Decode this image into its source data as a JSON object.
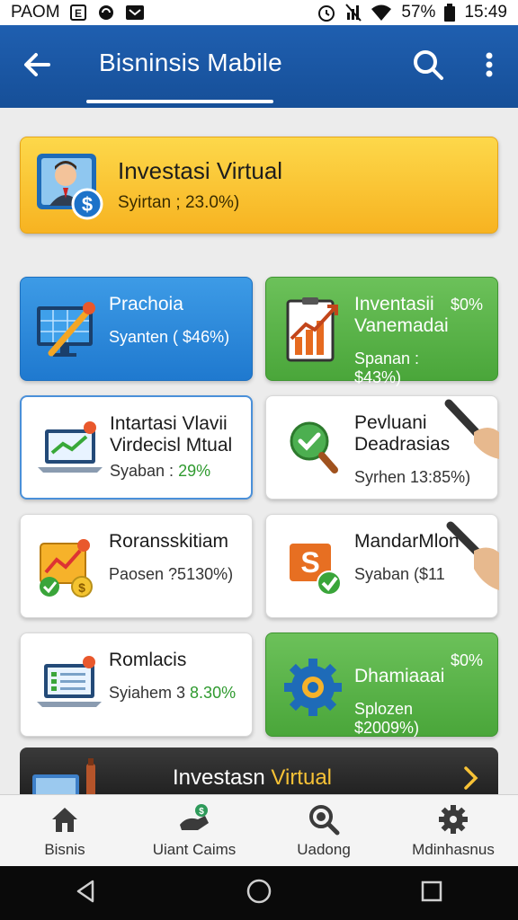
{
  "status_bar": {
    "carrier": "PAOM",
    "battery": "57%",
    "time": "15:49"
  },
  "app_bar": {
    "title": "Bisninsis Mabile",
    "icons": [
      "back-arrow-icon",
      "search-icon",
      "more-vert-icon"
    ]
  },
  "hero": {
    "title": "Investasi Virtual",
    "subtitle": "Syirtan ; 23.0%)"
  },
  "cards": [
    {
      "title": "Prachoia",
      "subtitle": "Syanten ( $46%)",
      "badge": "",
      "style": "blue",
      "icon": "chart-screen-icon"
    },
    {
      "title": "Inventasii Vanemadai",
      "subtitle": "Spanan : $43%)",
      "badge": "$0%",
      "style": "green",
      "icon": "growth-chart-icon"
    },
    {
      "title": "Intartasi Vlavii Virdecisl Mtual",
      "subtitle_prefix": "Syaban : ",
      "subtitle_value": "29%",
      "style": "outline",
      "icon": "laptop-chart-icon"
    },
    {
      "title": "Pevluani Deadrasias",
      "subtitle": "Syrhen 13:85%)",
      "style": "white",
      "icon": "magnifier-check-icon"
    },
    {
      "title": "Roransskitiam",
      "subtitle": "Paosen ?5130%)",
      "style": "white",
      "icon": "trend-coin-icon"
    },
    {
      "title": "MandarMlon",
      "subtitle": "Syaban ($11",
      "style": "white",
      "icon": "dollar-check-icon"
    },
    {
      "title": "Romlacis",
      "subtitle_prefix": "Syiahem 3 ",
      "subtitle_value": "8.30%",
      "style": "white",
      "icon": "laptop-list-icon"
    },
    {
      "title": "Dhamiaaai",
      "subtitle": "Splozen $2009%)",
      "badge": "$0%",
      "style": "green",
      "icon": "gear-icon"
    }
  ],
  "banner": {
    "text_main": "Investasn ",
    "text_highlight": "Virtual"
  },
  "bottom_nav": [
    {
      "label": "Bisnis",
      "icon": "home-icon"
    },
    {
      "label": "Uiant Caims",
      "icon": "hand-dollar-icon"
    },
    {
      "label": "Uadong",
      "icon": "search-coin-icon"
    },
    {
      "label": "Mdinhasnus",
      "icon": "settings-icon"
    }
  ],
  "colors": {
    "app_bar": "#1f5fb0",
    "hero": "#f7b321",
    "blue_card": "#2a86d8",
    "green_card": "#5ab348",
    "percent_green": "#2f9a2f",
    "banner_highlight": "#f7c236"
  }
}
